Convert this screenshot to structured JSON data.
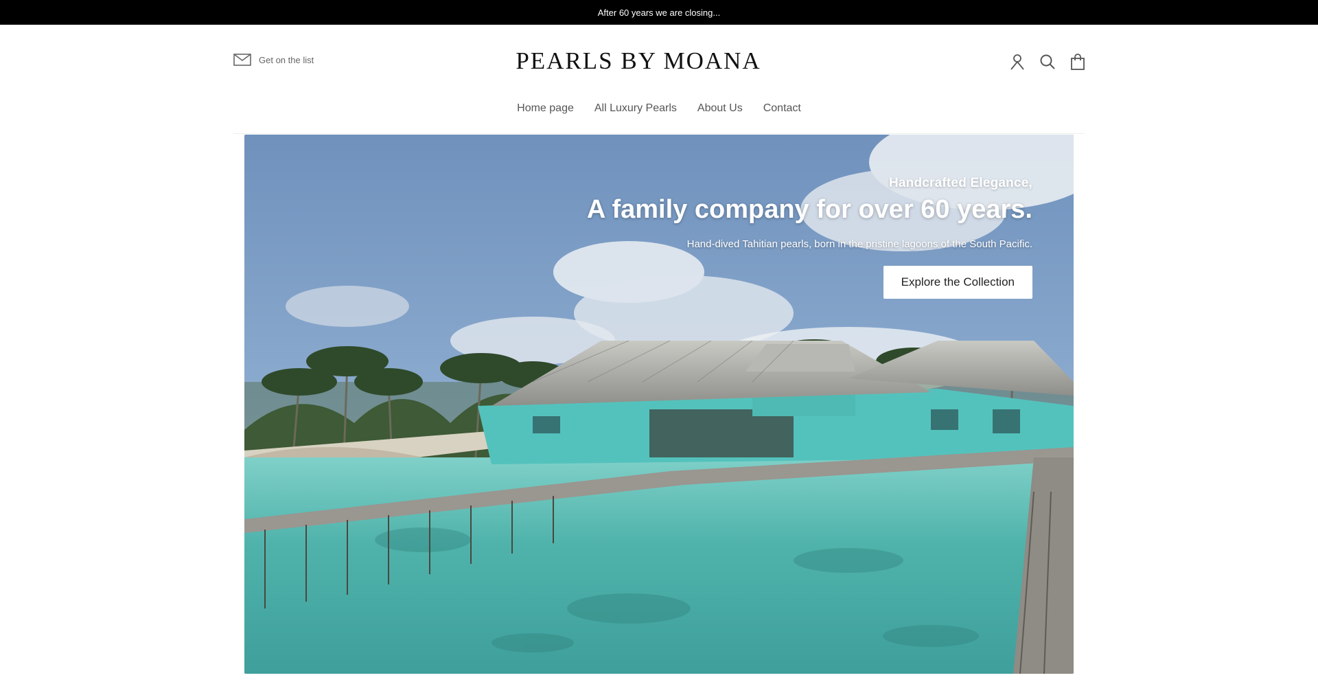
{
  "announcement": {
    "text": "After 60 years we are closing..."
  },
  "header": {
    "newsletter_label": "Get on the list",
    "logo_text": "PEARLS BY MOANA",
    "icons": [
      "account-icon",
      "search-icon",
      "cart-icon"
    ]
  },
  "nav": {
    "items": [
      {
        "label": "Home page"
      },
      {
        "label": "All Luxury Pearls"
      },
      {
        "label": "About Us"
      },
      {
        "label": "Contact"
      }
    ]
  },
  "hero": {
    "kicker": "Handcrafted Elegance,",
    "title": "A family company for over 60 years.",
    "subtitle": "Hand-dived Tahitian pearls, born in the pristine lagoons of the South Pacific.",
    "cta_label": "Explore the Collection"
  },
  "colors": {
    "announcement_bg": "#000000",
    "lagoon": "#5fc2b8",
    "sky": "#7d9ec4"
  }
}
